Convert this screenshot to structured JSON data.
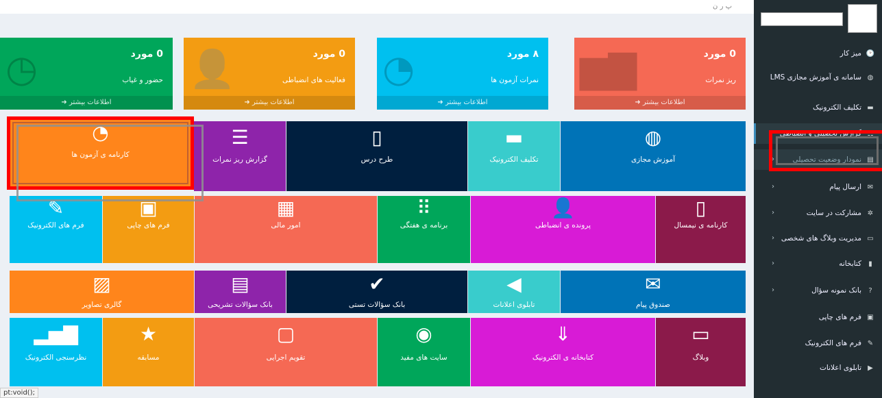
{
  "topbar": {
    "crumb": "پ ر ن"
  },
  "sidebar": {
    "items": [
      {
        "label": "میز کار",
        "icon": "dashboard-icon",
        "glyph": "🕑",
        "chev": false
      },
      {
        "label": "سامانه ی آموزش مجازی LMS",
        "icon": "globe-icon",
        "glyph": "◍",
        "chev": false
      },
      {
        "label": "تکلیف الکترونیک",
        "icon": "briefcase-icon",
        "glyph": "▬",
        "chev": false
      },
      {
        "label": "گزارش تحصیلی و انضباطی",
        "icon": "table-icon",
        "glyph": "☷",
        "chev": false
      },
      {
        "label": "نمودار وضعیت تحصیلی",
        "icon": "chart-icon",
        "glyph": "▤",
        "chev": true
      },
      {
        "label": "ارسال پیام",
        "icon": "envelope-icon",
        "glyph": "✉",
        "chev": true
      },
      {
        "label": "مشارکت در سایت",
        "icon": "gear-icon",
        "glyph": "✲",
        "chev": true
      },
      {
        "label": "مدیریت وبلاگ های شخصی",
        "icon": "desktop-icon",
        "glyph": "▭",
        "chev": true
      },
      {
        "label": "کتابخانه",
        "icon": "book-icon",
        "glyph": "▮",
        "chev": true
      },
      {
        "label": "بانک نمونه سؤال",
        "icon": "question-icon",
        "glyph": "?",
        "chev": true
      },
      {
        "label": "فرم های چاپی",
        "icon": "print-icon",
        "glyph": "▣",
        "chev": false
      },
      {
        "label": "فرم های الکترونیک",
        "icon": "edit-icon",
        "glyph": "✎",
        "chev": false
      },
      {
        "label": "تابلوی اعلانات",
        "icon": "bullhorn-icon",
        "glyph": "▶",
        "chev": false
      }
    ]
  },
  "stats": [
    {
      "num": "0 مورد",
      "sub": "ریز نمرات",
      "foot": "اطلاعات بیشتر",
      "color": "#f56954",
      "icon": "bar-chart-icon",
      "glyph": "▆▇"
    },
    {
      "num": "۸ مورد",
      "sub": "نمرات آزمون ها",
      "foot": "اطلاعات بیشتر",
      "color": "#00c0ef",
      "icon": "clock-icon",
      "glyph": "◔"
    },
    {
      "num": "0 مورد",
      "sub": "فعالیت های انضباطی",
      "foot": "اطلاعات بیشتر",
      "color": "#f39c12",
      "icon": "user-plus-icon",
      "glyph": "👤"
    },
    {
      "num": "0 مورد",
      "sub": "حضور و غیاب",
      "foot": "اطلاعات بیشتر",
      "color": "#00a65a",
      "icon": "clock-icon",
      "glyph": "◷"
    }
  ],
  "tiles": [
    {
      "label": "آموزش مجازی",
      "color": "#0073b7",
      "icon": "globe-icon",
      "glyph": "◍"
    },
    {
      "label": "تکلیف الکترونیک",
      "color": "#39cccc",
      "icon": "briefcase-icon",
      "glyph": "▬"
    },
    {
      "label": "طرح درس",
      "color": "#001f3f",
      "icon": "book-icon",
      "glyph": "▯"
    },
    {
      "label": "گزارش ریز نمرات",
      "color": "#8e24aa",
      "icon": "list-icon",
      "glyph": "☰"
    },
    {
      "label": "کارنامه ی آزمون ها",
      "color": "#ff851b",
      "icon": "clock-icon",
      "glyph": "◔"
    },
    {
      "label": "کارنامه ی نیمسال",
      "color": "#8b1a4a",
      "icon": "file-icon",
      "glyph": "▯"
    },
    {
      "label": "پرونده ی انضباطی",
      "color": "#d81bd6",
      "icon": "user-plus-icon",
      "glyph": "👤"
    },
    {
      "label": "برنامه ی هفتگی",
      "color": "#00a65a",
      "icon": "grid-icon",
      "glyph": "⠿"
    },
    {
      "label": "امور مالی",
      "color": "#f56954",
      "icon": "calculator-icon",
      "glyph": "▦"
    },
    {
      "label": "فرم های چاپی",
      "color": "#f39c12",
      "icon": "print-icon",
      "glyph": "▣"
    },
    {
      "label": "فرم های الکترونیک",
      "color": "#00c0ef",
      "icon": "edit-icon",
      "glyph": "✎"
    },
    {
      "label": "صندوق پیام",
      "color": "#0073b7",
      "icon": "envelope-icon",
      "glyph": "✉"
    },
    {
      "label": "تابلوی اعلانات",
      "color": "#39cccc",
      "icon": "bullhorn-icon",
      "glyph": "◀"
    },
    {
      "label": "بانک سؤالات تستی",
      "color": "#001f3f",
      "icon": "check-circle-icon",
      "glyph": "✔"
    },
    {
      "label": "بانک سؤالات تشریحی",
      "color": "#8e24aa",
      "icon": "document-icon",
      "glyph": "▤"
    },
    {
      "label": "گالری تصاویر",
      "color": "#ff851b",
      "icon": "image-icon",
      "glyph": "▨"
    },
    {
      "label": "وبلاگ",
      "color": "#8b1a4a",
      "icon": "laptop-icon",
      "glyph": "▭"
    },
    {
      "label": "کتابخانه ی الکترونیک",
      "color": "#d81bd6",
      "icon": "download-icon",
      "glyph": "⇓"
    },
    {
      "label": "سایت های مفید",
      "color": "#00a65a",
      "icon": "lightbulb-icon",
      "glyph": "◉"
    },
    {
      "label": "تقویم اجرایی",
      "color": "#f56954",
      "icon": "calendar-icon",
      "glyph": "▢"
    },
    {
      "label": "مسابقه",
      "color": "#f39c12",
      "icon": "star-icon",
      "glyph": "★"
    },
    {
      "label": "نظرسنجی الکترونیک",
      "color": "#00c0ef",
      "icon": "bar-chart-icon",
      "glyph": "▂▅▇"
    }
  ],
  "statusbar": "pt:void();"
}
